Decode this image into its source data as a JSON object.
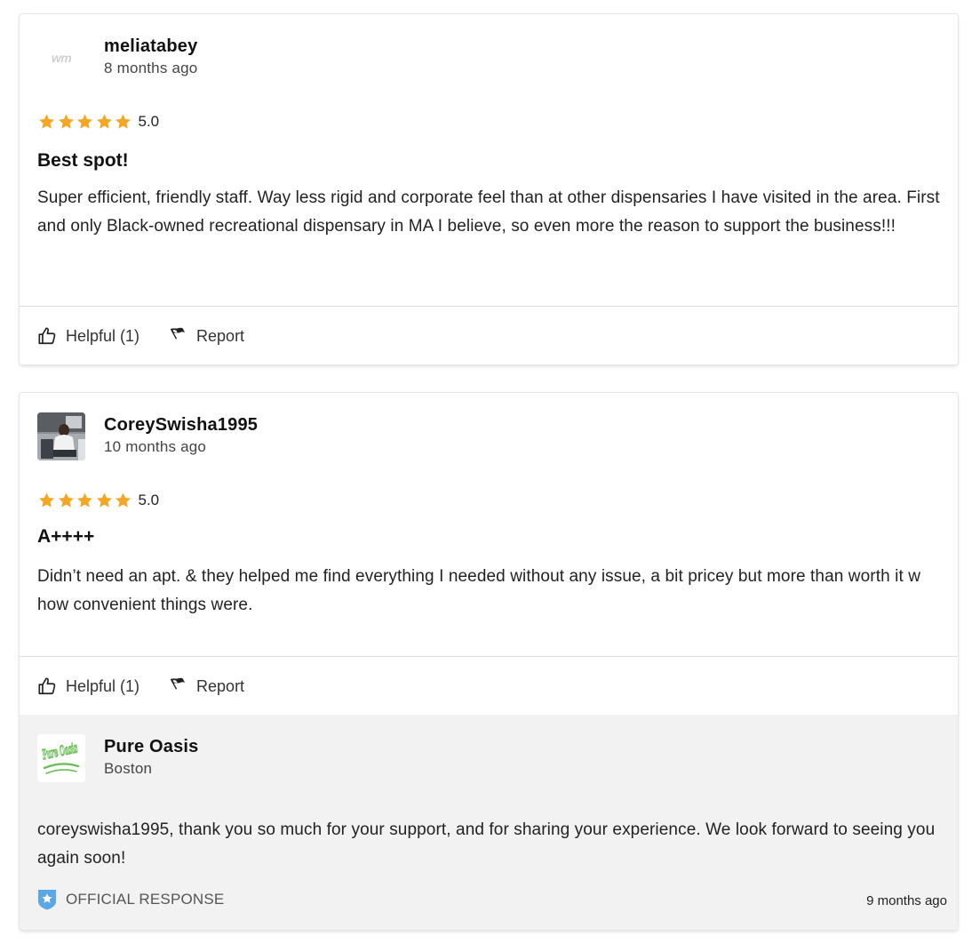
{
  "reviews": [
    {
      "username": "meliatabey",
      "time_ago": "8 months ago",
      "avatar_text": "wm",
      "rating": 5.0,
      "rating_label": "5.0",
      "title": "Best spot!",
      "body": "Super efficient, friendly staff. Way less rigid and corporate feel than at other dispensaries I have visited in the area. First and only Black-owned recreational dispensary in MA I believe, so even more the reason to support the business!!!",
      "helpful_label": "Helpful (1)",
      "report_label": "Report"
    },
    {
      "username": "CoreySwisha1995",
      "time_ago": "10 months ago",
      "rating": 5.0,
      "rating_label": "5.0",
      "title": "A++++",
      "body": "Didn’t need an apt. & they helped me find everything I needed without any issue, a bit pricey but more than worth it w how convenient things were.",
      "helpful_label": "Helpful (1)",
      "report_label": "Report",
      "response": {
        "business_name": "Pure Oasis",
        "location": "Boston",
        "logo_text": "Pure Oasis",
        "message": "coreyswisha1995, thank you so much for your support, and for sharing your experience. We look forward to seeing you again soon!",
        "badge_label": "OFFICIAL RESPONSE",
        "time_ago": "9 months ago"
      }
    }
  ],
  "colors": {
    "star": "#f5a623",
    "divider": "#dcdcdc",
    "response_bg": "#f1f2f1",
    "badge_blue": "#5aa7e6",
    "logo_green": "#6bbf59"
  }
}
